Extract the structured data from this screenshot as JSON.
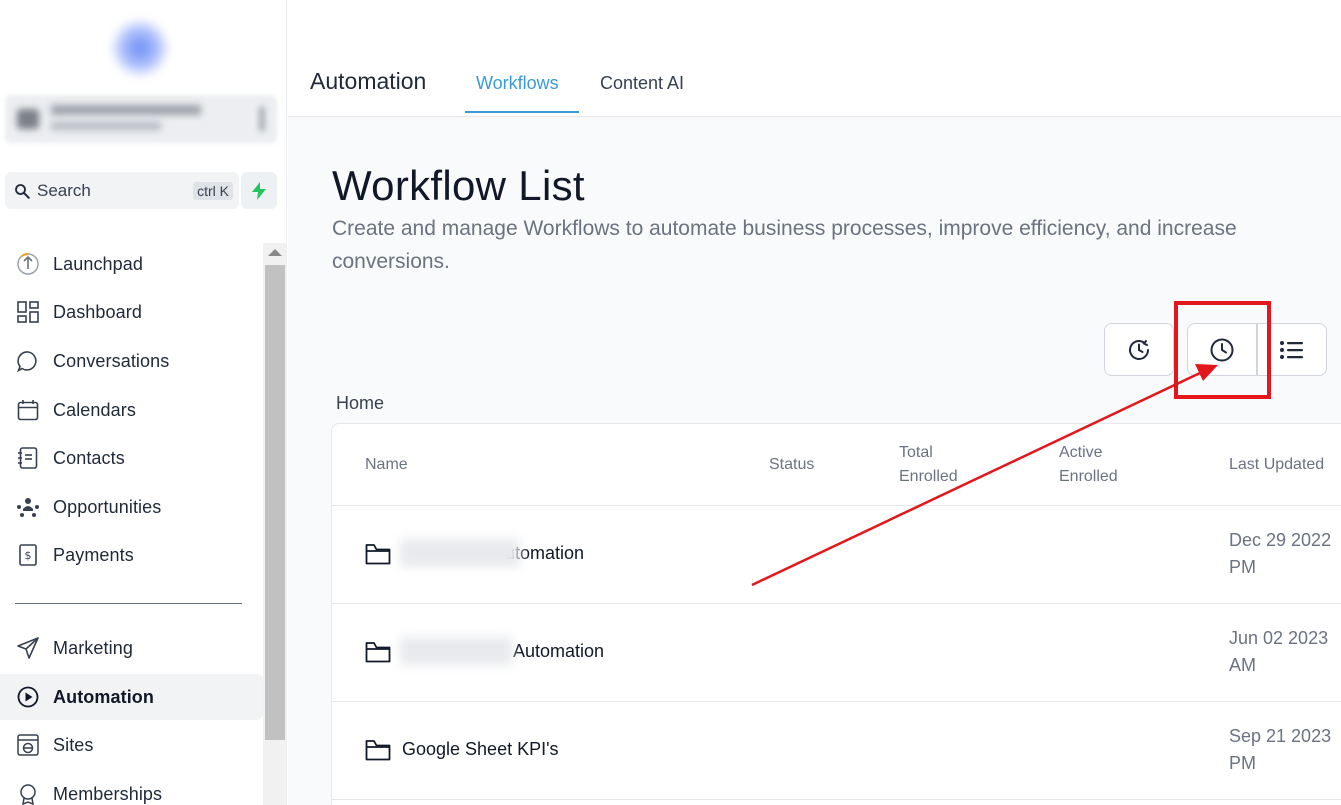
{
  "sidebar": {
    "search": {
      "label": "Search",
      "shortcut": "ctrl K"
    },
    "items": [
      {
        "label": "Launchpad",
        "icon": "launchpad-icon"
      },
      {
        "label": "Dashboard",
        "icon": "dashboard-icon"
      },
      {
        "label": "Conversations",
        "icon": "chat-bubble-icon"
      },
      {
        "label": "Calendars",
        "icon": "calendar-icon"
      },
      {
        "label": "Contacts",
        "icon": "contacts-icon"
      },
      {
        "label": "Opportunities",
        "icon": "opportunities-icon"
      },
      {
        "label": "Payments",
        "icon": "payments-icon"
      },
      {
        "label": "Marketing",
        "icon": "send-icon"
      },
      {
        "label": "Automation",
        "icon": "automation-icon",
        "active": true
      },
      {
        "label": "Sites",
        "icon": "sites-icon"
      },
      {
        "label": "Memberships",
        "icon": "memberships-icon"
      }
    ]
  },
  "header": {
    "title": "Automation",
    "tabs": [
      {
        "label": "Workflows",
        "active": true
      },
      {
        "label": "Content AI",
        "active": false
      }
    ]
  },
  "main": {
    "title": "Workflow List",
    "description": "Create and manage Workflows to automate business processes, improve efficiency, and increase conversions.",
    "breadcrumb": "Home",
    "toolbar": {
      "history_icon": "clock-history-icon",
      "clock_icon": "clock-icon",
      "list_icon": "list-view-icon"
    },
    "table": {
      "columns": [
        "Name",
        "Status",
        "Total Enrolled",
        "Active Enrolled",
        "Last Updated"
      ],
      "column_lines": {
        "total": [
          "Total",
          "Enrolled"
        ],
        "active": [
          "Active",
          "Enrolled"
        ]
      },
      "rows": [
        {
          "name": "utomation",
          "updated_line1": "Dec 29 2022",
          "updated_line2": "PM"
        },
        {
          "name": "Automation",
          "updated_line1": "Jun 02 2023",
          "updated_line2": "AM"
        },
        {
          "name": "Google Sheet KPI's",
          "updated_line1": "Sep 21 2023",
          "updated_line2": "PM"
        }
      ]
    }
  },
  "colors": {
    "accent": "#3b9ad9",
    "highlight": "#e3161b",
    "bolt": "#22c55e"
  }
}
